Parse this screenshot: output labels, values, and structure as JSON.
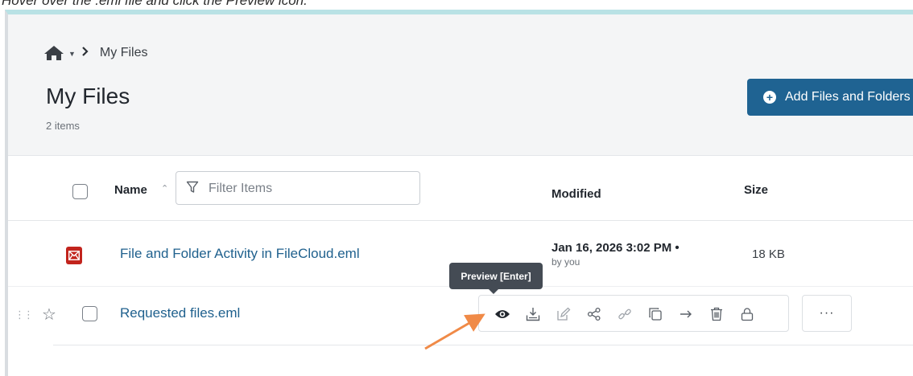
{
  "instruction": "Hover over the .eml file and click the Preview icon.",
  "breadcrumb": {
    "label": "My Files",
    "home_icon": "home-icon"
  },
  "header": {
    "title": "My Files",
    "item_count": "2 items",
    "add_button_label": "Add Files and Folders"
  },
  "columns": {
    "name": "Name",
    "modified": "Modified",
    "size": "Size"
  },
  "filter": {
    "placeholder": "Filter Items"
  },
  "files": [
    {
      "name": "File and Folder Activity in FileCloud.eml",
      "modified": "Jan 16, 2026 3:02 PM •",
      "modified_by": "by you",
      "size": "18 KB",
      "icon": "email-file-icon"
    },
    {
      "name": "Requested files.eml",
      "icon": "email-file-icon"
    }
  ],
  "tooltip": {
    "text": "Preview [Enter]"
  },
  "row_actions": [
    "preview-icon",
    "download-icon",
    "edit-icon",
    "share-icon",
    "link-icon",
    "copy-icon",
    "move-icon",
    "delete-icon",
    "lock-icon"
  ],
  "more_label": "···",
  "colors": {
    "accent": "#1f6392",
    "link": "#20618e",
    "annotation_arrow": "#f08a47",
    "top_border": "#b9e2e5",
    "email_icon": "#c2241d"
  }
}
